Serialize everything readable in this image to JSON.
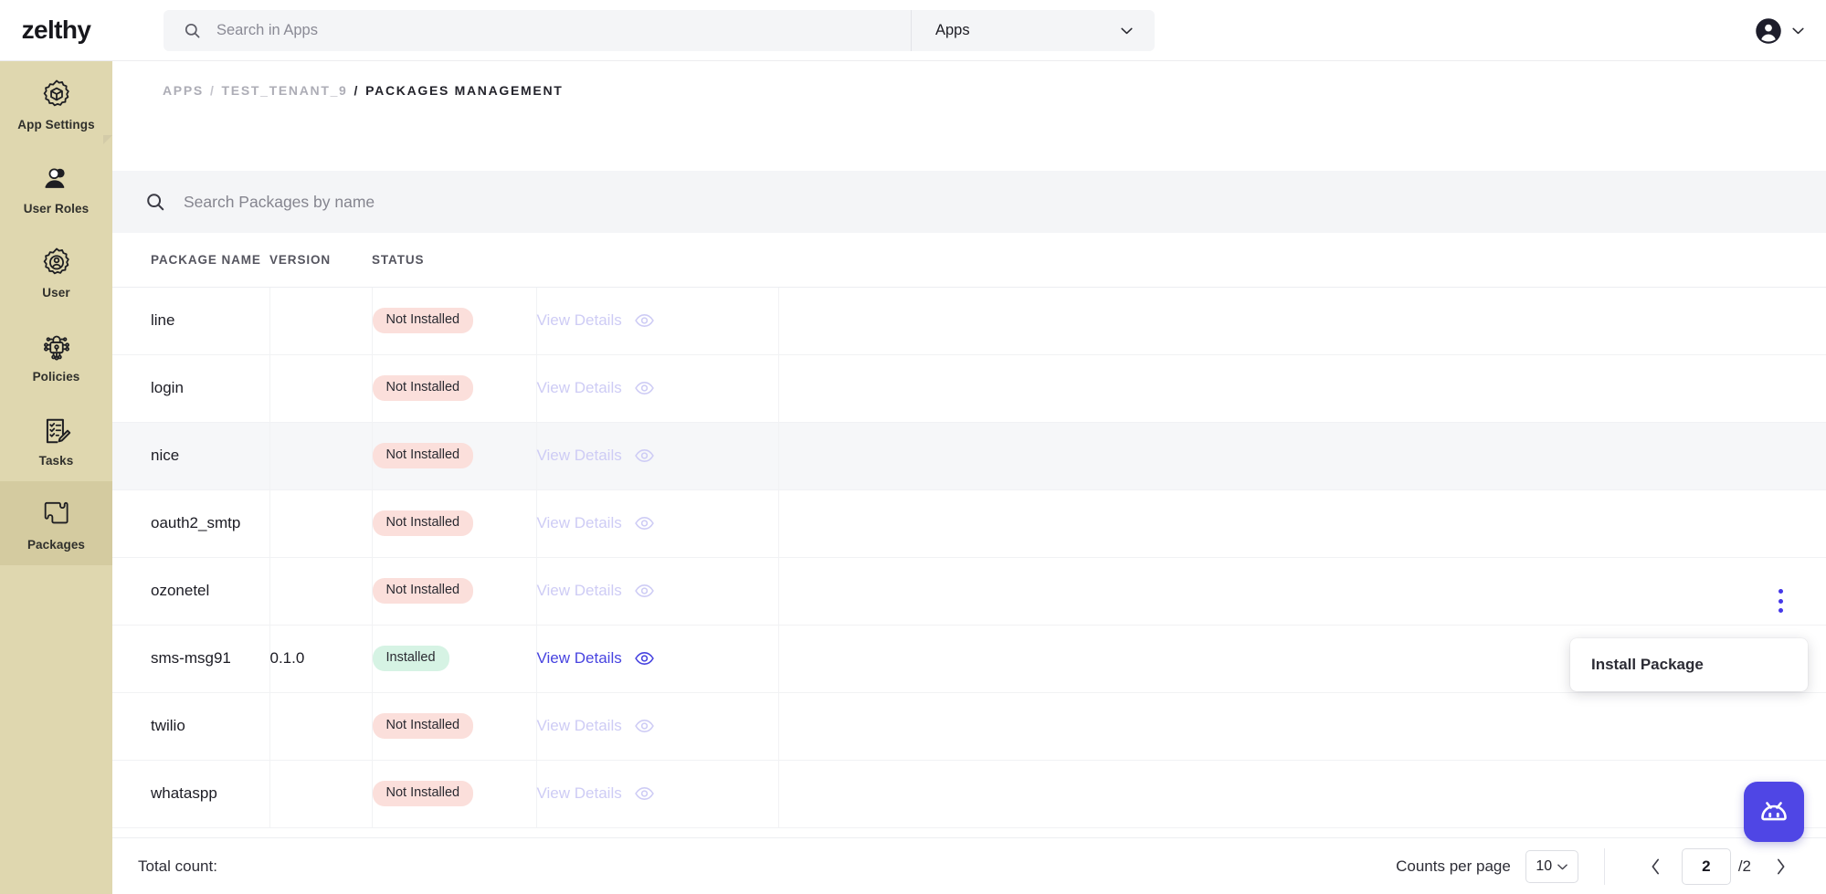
{
  "topbar": {
    "brand": "zelthy",
    "search_placeholder": "Search in Apps",
    "search_value": "",
    "apps_selected": "Apps",
    "search_icon": "search-icon",
    "chevron_icon": "chevron-down-icon",
    "avatar_icon": "account-circle-icon"
  },
  "sidebar": {
    "items": [
      {
        "label": "App Settings",
        "icon": "gear-cube-icon",
        "active": false
      },
      {
        "label": "User Roles",
        "icon": "user-roles-icon",
        "active": false
      },
      {
        "label": "User",
        "icon": "gear-user-icon",
        "active": false
      },
      {
        "label": "Policies",
        "icon": "policy-lock-icon",
        "active": false
      },
      {
        "label": "Tasks",
        "icon": "checklist-pencil-icon",
        "active": false
      },
      {
        "label": "Packages",
        "icon": "puzzle-piece-icon",
        "active": true
      }
    ]
  },
  "breadcrumb": {
    "root": "APPS",
    "tenant": "TEST_TENANT_9",
    "current": "PACKAGES MANAGEMENT",
    "separator": "/"
  },
  "package_search": {
    "placeholder": "Search Packages by name",
    "value": "",
    "icon": "search-icon"
  },
  "table": {
    "columns": [
      "PACKAGE NAME",
      "VERSION",
      "STATUS",
      "",
      ""
    ],
    "details_label": "View Details",
    "eye_icon": "eye-icon",
    "rows": [
      {
        "name": "line",
        "version": "",
        "status": "Not Installed",
        "installed": false,
        "hover": false
      },
      {
        "name": "login",
        "version": "",
        "status": "Not Installed",
        "installed": false,
        "hover": false
      },
      {
        "name": "nice",
        "version": "",
        "status": "Not Installed",
        "installed": false,
        "hover": true
      },
      {
        "name": "oauth2_smtp",
        "version": "",
        "status": "Not Installed",
        "installed": false,
        "hover": false
      },
      {
        "name": "ozonetel",
        "version": "",
        "status": "Not Installed",
        "installed": false,
        "hover": false
      },
      {
        "name": "sms-msg91",
        "version": "0.1.0",
        "status": "Installed",
        "installed": true,
        "hover": false
      },
      {
        "name": "twilio",
        "version": "",
        "status": "Not Installed",
        "installed": false,
        "hover": false
      },
      {
        "name": "whataspp",
        "version": "",
        "status": "Not Installed",
        "installed": false,
        "hover": false
      }
    ]
  },
  "context_menu": {
    "kebab_icon": "more-vertical-icon",
    "install_label": "Install Package"
  },
  "footer": {
    "total_label": "Total count:",
    "counts_per_page_label": "Counts per page",
    "counts_per_page_value": "10",
    "prev_icon": "chevron-left-icon",
    "next_icon": "chevron-right-icon",
    "current_page": "2",
    "total_pages": "/2"
  },
  "chatbot": {
    "icon": "robot-face-icon"
  },
  "colors": {
    "sidebar_bg": "#dfd7af",
    "sidebar_active": "#d4cba0",
    "accent": "#4743e0",
    "badge_not_installed": "#fbdfdb",
    "badge_installed": "#d6f3e4",
    "chatbot": "#4f46e5"
  }
}
